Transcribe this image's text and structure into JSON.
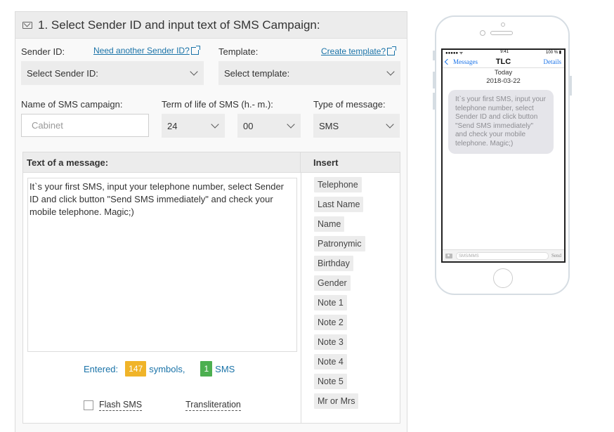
{
  "section": {
    "title": "1. Select Sender ID and input text of SMS Campaign:"
  },
  "sender": {
    "label": "Sender ID:",
    "link": "Need another Sender ID?",
    "select": "Select Sender ID:"
  },
  "template": {
    "label": "Template:",
    "link": "Create template?",
    "select": "Select template:"
  },
  "campaign": {
    "label": "Name of SMS campaign:",
    "placeholder": "Cabinet"
  },
  "term": {
    "label": "Term of life of SMS (h.- m.):",
    "hours": "24",
    "minutes": "00"
  },
  "type": {
    "label": "Type of message:",
    "value": "SMS"
  },
  "message": {
    "header": "Text of a message:",
    "text": "It`s your first SMS, input your telephone number, select Sender ID and click button \"Send SMS immediately\" and check your mobile telephone. Magic;)"
  },
  "insert": {
    "header": "Insert",
    "items": [
      "Telephone",
      "Last Name",
      "Name",
      "Patronymic",
      "Birthday",
      "Gender",
      "Note 1",
      "Note 2",
      "Note 3",
      "Note 4",
      "Note 5",
      "Mr or Mrs"
    ]
  },
  "counter": {
    "entered_label": "Entered:",
    "symbols": "147",
    "symbols_label": "symbols,",
    "sms": "1",
    "sms_label": "SMS"
  },
  "options": {
    "flash": "Flash SMS",
    "translit": "Transliteration"
  },
  "phone": {
    "status_left": "●●●●● ᯤ",
    "status_time": "9:41",
    "status_right": "100 % ▮",
    "back": "Messages",
    "title": "TLC",
    "details": "Details",
    "day": "Today",
    "date": "2018-03-22",
    "bubble": "It`s your first SMS, input your telephone number, select Sender ID and click button \"Send SMS immediately\" and check your mobile telephone. Magic;)",
    "compose_placeholder": "SMS/MMS",
    "send": "Send"
  },
  "colors": {
    "link": "#1a73a8",
    "symbols_badge": "#f0b429",
    "sms_badge": "#4caf50"
  }
}
